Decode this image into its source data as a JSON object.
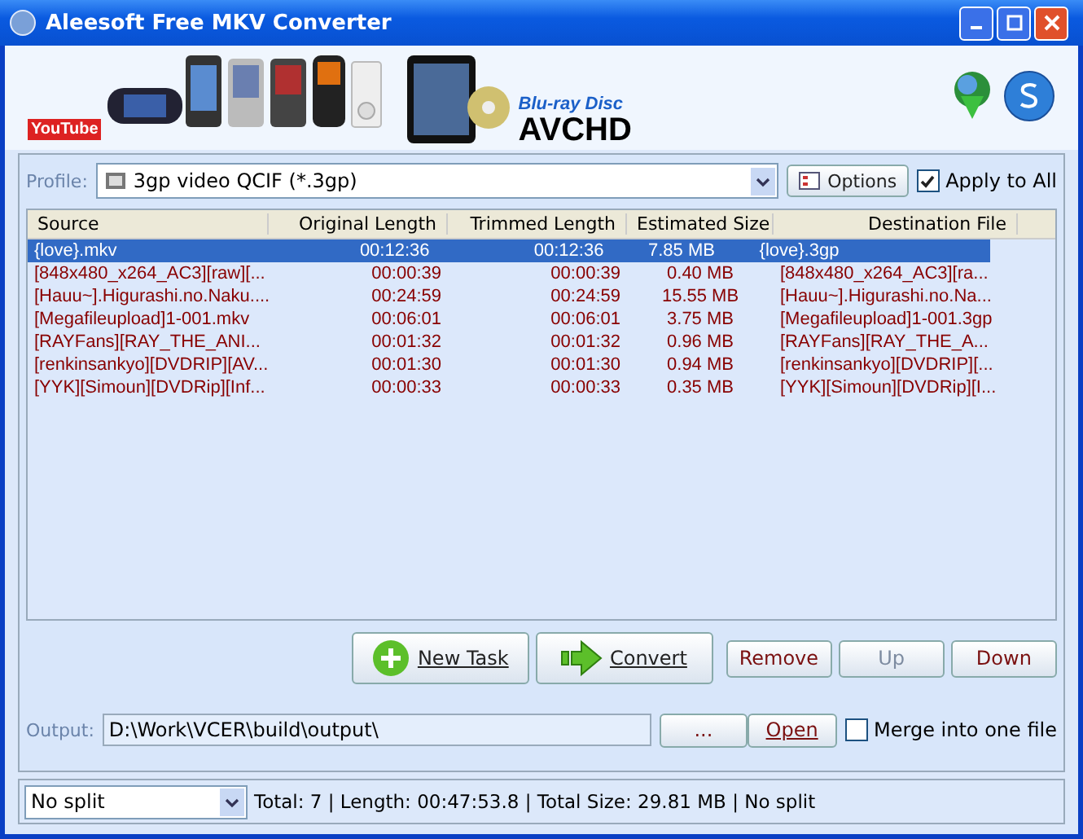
{
  "window": {
    "title": "Aleesoft Free MKV Converter"
  },
  "banner": {
    "logos": [
      "YouTube",
      "Blu-ray Disc",
      "AVCHD"
    ]
  },
  "profile": {
    "label": "Profile:",
    "value": "3gp video QCIF (*.3gp)",
    "options_button": "Options",
    "apply_to_all": {
      "label": "Apply to All",
      "checked": true
    }
  },
  "table": {
    "columns": [
      "Source",
      "Original Length",
      "Trimmed Length",
      "Estimated Size",
      "Destination File"
    ],
    "rows": [
      {
        "cells": [
          "{love}.mkv",
          "00:12:36",
          "00:12:36",
          "7.85 MB",
          "{love}.3gp"
        ],
        "selected": true
      },
      {
        "cells": [
          "[848x480_x264_AC3][raw][...",
          "00:00:39",
          "00:00:39",
          "0.40 MB",
          "[848x480_x264_AC3][ra..."
        ],
        "selected": false
      },
      {
        "cells": [
          "[Hauu~].Higurashi.no.Naku....",
          "00:24:59",
          "00:24:59",
          "15.55 MB",
          "[Hauu~].Higurashi.no.Na..."
        ],
        "selected": false
      },
      {
        "cells": [
          "[Megafileupload]1-001.mkv",
          "00:06:01",
          "00:06:01",
          "3.75 MB",
          "[Megafileupload]1-001.3gp"
        ],
        "selected": false
      },
      {
        "cells": [
          "[RAYFans][RAY_THE_ANI...",
          "00:01:32",
          "00:01:32",
          "0.96 MB",
          "[RAYFans][RAY_THE_A..."
        ],
        "selected": false
      },
      {
        "cells": [
          "[renkinsankyo][DVDRIP][AV...",
          "00:01:30",
          "00:01:30",
          "0.94 MB",
          "[renkinsankyo][DVDRIP][..."
        ],
        "selected": false
      },
      {
        "cells": [
          "[YYK][Simoun][DVDRip][Inf...",
          "00:00:33",
          "00:00:33",
          "0.35 MB",
          "[YYK][Simoun][DVDRip][I..."
        ],
        "selected": false
      }
    ]
  },
  "actions": [
    {
      "label": "New Task",
      "kind": "add"
    },
    {
      "label": "Convert",
      "kind": "convert"
    }
  ],
  "list_buttons": [
    {
      "label": "Remove",
      "disabled": false
    },
    {
      "label": "Up",
      "disabled": true
    },
    {
      "label": "Down",
      "disabled": false
    }
  ],
  "output": {
    "label": "Output:",
    "value": "D:\\Work\\VCER\\build\\output\\",
    "browse_button": "...",
    "open_button": "Open",
    "merge": {
      "label": "Merge into one file",
      "checked": false
    }
  },
  "status_bar": {
    "split": "No split",
    "summary": "Total: 7 | Length: 00:47:53.8 | Total Size: 29.81 MB | No split"
  }
}
